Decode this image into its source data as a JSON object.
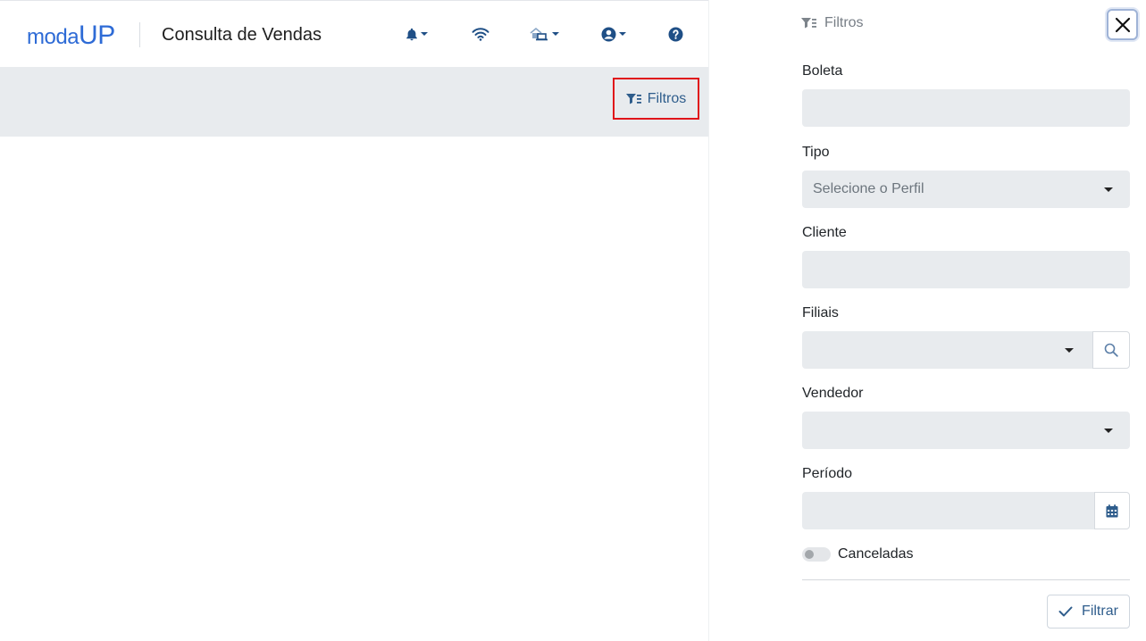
{
  "header": {
    "logo_prefix": "moda",
    "logo_suffix": "UP",
    "title": "Consulta de Vendas",
    "icons": [
      "bell-icon",
      "wifi-icon",
      "store-icon",
      "user-icon",
      "help-icon"
    ]
  },
  "toolbar": {
    "filter_label": "Filtros"
  },
  "panel": {
    "title": "Filtros",
    "fields": {
      "boleta": {
        "label": "Boleta",
        "value": ""
      },
      "tipo": {
        "label": "Tipo",
        "placeholder": "Selecione o Perfil"
      },
      "cliente": {
        "label": "Cliente",
        "value": ""
      },
      "filiais": {
        "label": "Filiais",
        "value": ""
      },
      "vendedor": {
        "label": "Vendedor",
        "value": ""
      },
      "periodo": {
        "label": "Período",
        "value": ""
      }
    },
    "canceladas_label": "Canceladas",
    "canceladas_checked": false,
    "apply_label": "Filtrar"
  },
  "colors": {
    "brand": "#2e6bd6",
    "accent": "#2f5d8c",
    "highlight": "#e0141a",
    "field_bg": "#e8ebee"
  }
}
